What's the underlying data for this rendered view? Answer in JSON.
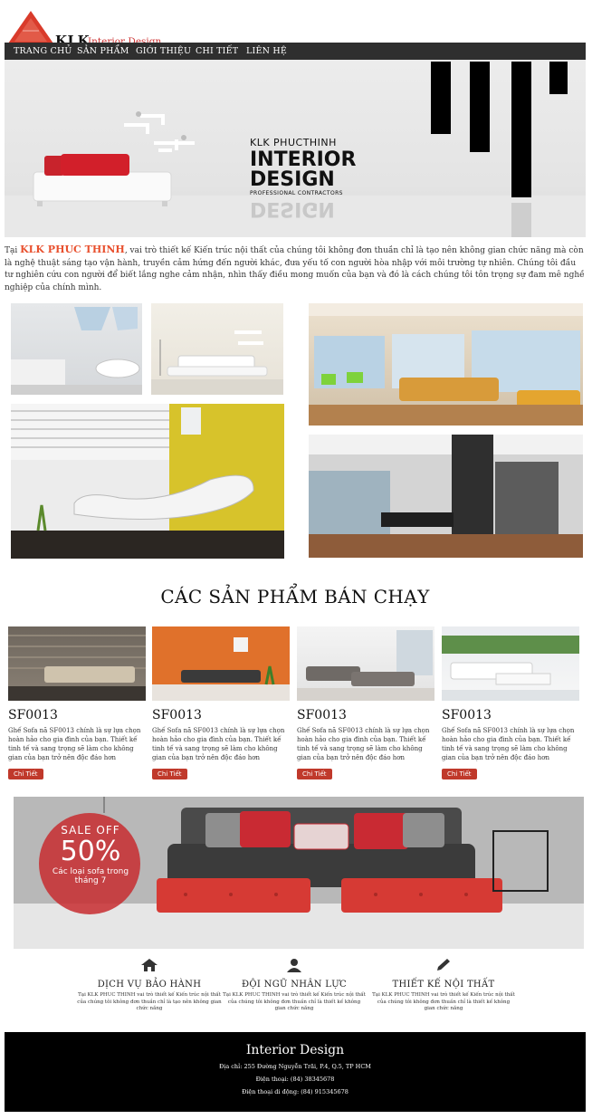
{
  "header": {
    "logo_text": "KLK",
    "logo_sub": "Interior Design",
    "nav": [
      "TRANG CHỦ",
      "SẢN PHẨM",
      "GIỚI THIỆU",
      "CHI TIẾT",
      "LIÊN HỆ"
    ]
  },
  "hero": {
    "line1": "KLK PHUCTHINH",
    "line2": "INTERIOR",
    "line3": "DESIGN",
    "line4": "PROFESSIONAL CONTRACTORS",
    "reflection": "DESIGN"
  },
  "intro": {
    "prefix": "Tại ",
    "brand": "KLK PHUC THINH",
    "text": ", vai trò thiết kế Kiến trúc nội thất của chúng tôi không đơn thuần chỉ là tạo nên không gian chức năng mà còn là nghệ thuật sáng tạo vận hành, truyền cảm hứng đến người khác, đưa yếu tố con người hòa nhập với môi trường tự nhiên. Chúng tôi đầu tư nghiên cứu con người để biết lắng nghe cảm nhận, nhìn thấy điều mong muốn của bạn và đó là cách chúng tôi tôn trọng sự đam mê nghề nghiệp của chính mình."
  },
  "bestsellers": {
    "title": "CÁC SẢN PHẨM BÁN CHẠY",
    "products": [
      {
        "code": "SF0013",
        "desc": "Ghế Sofa nã SF0013 chính là sự lựa chọn hoàn hảo cho gia đình của bạn. Thiết kế tinh tế và sang trọng sẽ làm cho không gian của bạn trở nên độc đáo hơn",
        "button": "Chi Tiết"
      },
      {
        "code": "SF0013",
        "desc": "Ghế Sofa nã SF0013 chính là sự lựa chọn hoàn hảo cho gia đình của bạn. Thiết kế tinh tế và sang trọng sẽ làm cho không gian của bạn trở nên độc đáo hơn",
        "button": "Chi Tiết"
      },
      {
        "code": "SF0013",
        "desc": "Ghế Sofa nã SF0013 chính là sự lựa chọn hoàn hảo cho gia đình của bạn. Thiết kế tinh tế và sang trọng sẽ làm cho không gian của bạn trở nên độc đáo hơn",
        "button": "Chi Tiết"
      },
      {
        "code": "SF0013",
        "desc": "Ghế Sofa nã SF0013 chính là sự lựa chọn hoàn hảo cho gia đình của bạn. Thiết kế tinh tế và sang trọng sẽ làm cho không gian của bạn trở nên độc đáo hơn",
        "button": "Chi Tiết"
      }
    ]
  },
  "promo": {
    "sale": "SALE OFF",
    "percent": "50%",
    "caption1": "Các loại sofa trong",
    "caption2": "tháng 7"
  },
  "services": [
    {
      "icon": "home-icon",
      "title": "DỊCH VỤ BẢO HÀNH",
      "text": "Tại KLK PHUC THINH vai trò thiết kế Kiến trúc nội thất của chúng tôi không đơn thuần chỉ là tạo nên không gian chức năng"
    },
    {
      "icon": "user-icon",
      "title": "ĐỘI NGŨ NHÂN LỰC",
      "text": "Tại KLK PHUC THINH vai trò thiết kế Kiến trúc nội thất của chúng tôi không đơn thuần chỉ là thiết kế không gian chức năng"
    },
    {
      "icon": "pencil-icon",
      "title": "THIẾT KẾ NỘI THẤT",
      "text": "Tại KLK PHUC THINH vai trò thiết kế Kiến trúc nội thất của chúng tôi không đơn thuần chỉ là thiết kế không gian chức năng"
    }
  ],
  "footer": {
    "title": "Interior Design",
    "address": "Địa chỉ: 255 Đường Nguyễn Trãi, P.4, Q.5, TP HCM",
    "phone": "Điện thoại: (84) 38345678",
    "mobile": "Điện thoại di động: (84) 915345678"
  },
  "colors": {
    "nav_bg": "#2f2f2f",
    "brand_red": "#e8502e",
    "button_red": "#c0392b",
    "footer_bg": "#000000"
  }
}
